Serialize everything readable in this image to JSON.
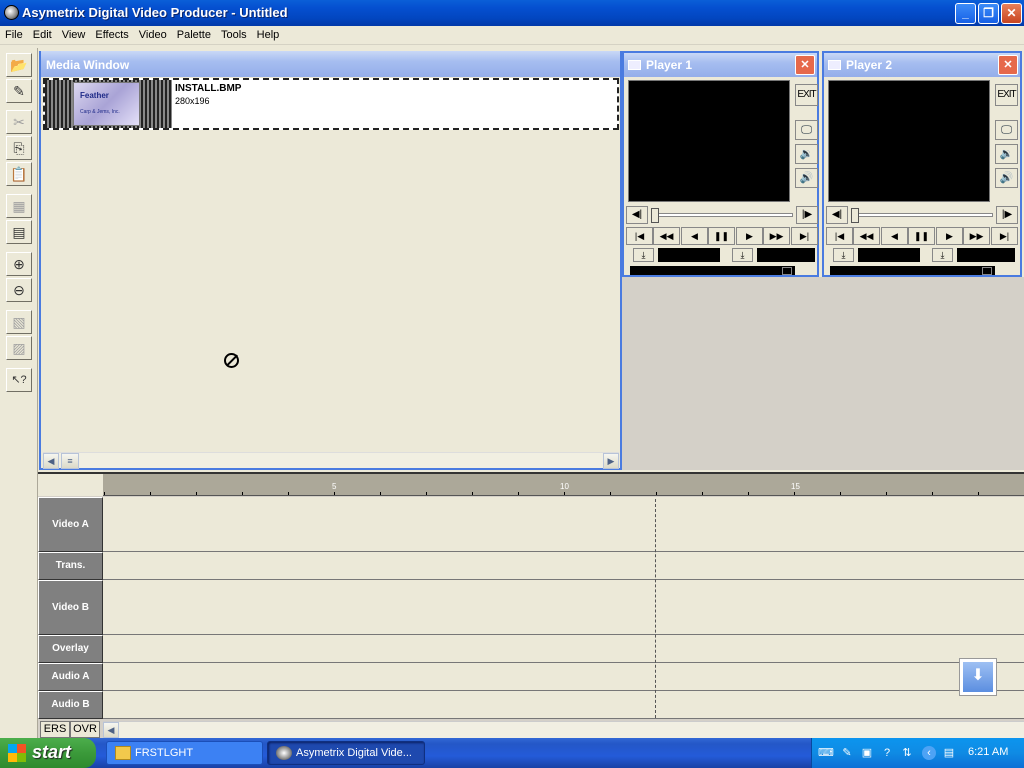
{
  "window": {
    "title": "Asymetrix Digital Video Producer - Untitled",
    "min": "_",
    "max": "❐",
    "close": "✕"
  },
  "menu": [
    "File",
    "Edit",
    "View",
    "Effects",
    "Video",
    "Palette",
    "Tools",
    "Help"
  ],
  "toolbar": {
    "open": "📂",
    "edit": "✎",
    "cut": "✂",
    "copy": "⎘",
    "paste": "📋",
    "film1": "▦",
    "film2": "▤",
    "zoom_in": "⊕",
    "zoom_out": "⊖",
    "clip1": "▧",
    "clip2": "▨",
    "help": "↖?"
  },
  "media_window": {
    "title": "Media Window",
    "items": [
      {
        "name": "INSTALL.BMP",
        "dimensions": "280x196",
        "thumb_logo": "Feather",
        "thumb_sub": "Carp & Jems, Inc."
      }
    ]
  },
  "players": [
    {
      "title": "Player 1",
      "exit": "EXIT"
    },
    {
      "title": "Player 2",
      "exit": "EXIT"
    }
  ],
  "player_icons": {
    "close": "✕",
    "monitor": "🖵",
    "speaker_low": "🔉",
    "speaker": "🔊",
    "slider_left": "◀|",
    "slider_right": "|▶",
    "first": "|◀",
    "rewind": "◀◀",
    "back": "◀",
    "pause": "❚❚",
    "play": "▶",
    "ffwd": "▶▶",
    "last": "▶|",
    "mark": "⤓"
  },
  "timeline": {
    "ruler_labels": [
      "5",
      "10",
      "15"
    ],
    "tracks": [
      "Video A",
      "Trans.",
      "Video B",
      "Overlay",
      "Audio A",
      "Audio B"
    ],
    "status": {
      "ers": "ERS",
      "ovr": "OVR"
    },
    "scroll_arrow": "◀",
    "down_button": "⬇"
  },
  "taskbar": {
    "start": "start",
    "tasks": [
      {
        "label": "FRSTLGHT"
      },
      {
        "label": "Asymetrix Digital Vide..."
      }
    ],
    "clock": "6:21 AM"
  },
  "colors": {
    "accent": "#4A7BE0",
    "title_gradient": "#0550D0",
    "start": "#3B9A3A"
  }
}
